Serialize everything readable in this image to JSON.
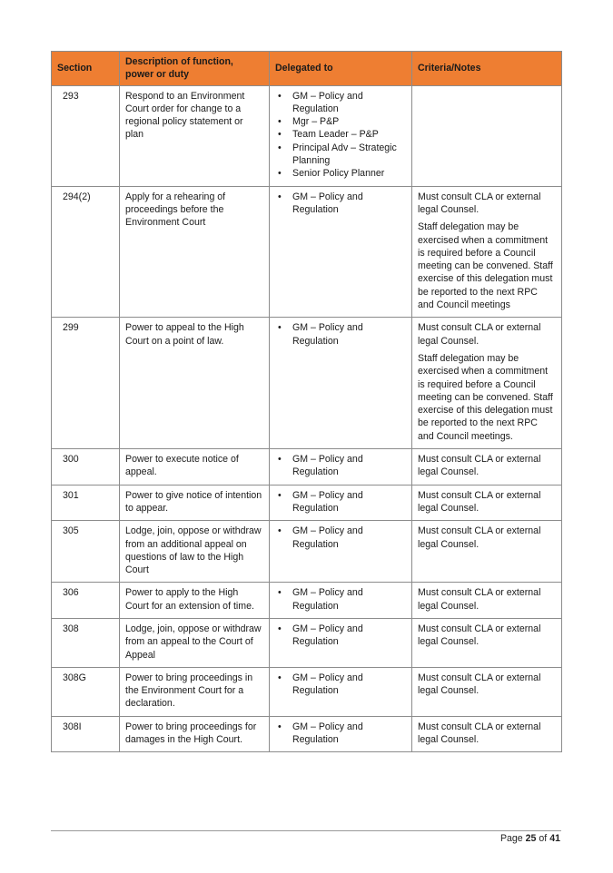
{
  "table": {
    "header_color": "#ee7e32",
    "headers": {
      "section": "Section",
      "description": "Description of function, power or duty",
      "delegated": "Delegated to",
      "criteria": "Criteria/Notes"
    },
    "rows": [
      {
        "section": "293",
        "description": "Respond to an Environment Court order for change to a regional policy statement or plan",
        "delegated": [
          "GM – Policy and Regulation",
          "Mgr – P&P",
          "Team Leader – P&P",
          "Principal Adv – Strategic Planning",
          "Senior Policy Planner"
        ],
        "notes": []
      },
      {
        "section": "294(2)",
        "description": "Apply for a rehearing of proceedings before the Environment Court",
        "delegated": [
          "GM – Policy and Regulation"
        ],
        "notes": [
          "Must consult CLA or external legal Counsel.",
          "Staff delegation may be exercised when a commitment is required before a Council meeting can be convened. Staff exercise of this delegation must be reported to the next RPC and Council meetings"
        ]
      },
      {
        "section": "299",
        "description": "Power to appeal to the High Court on a point of law.",
        "delegated": [
          "GM – Policy and Regulation"
        ],
        "notes": [
          "Must consult CLA or external legal Counsel.",
          "Staff delegation may be exercised when a commitment is required before a Council meeting can be convened. Staff exercise of this delegation must be reported to the next RPC and Council meetings."
        ]
      },
      {
        "section": "300",
        "description": "Power to execute notice of appeal.",
        "delegated": [
          "GM – Policy and Regulation"
        ],
        "notes": [
          "Must consult CLA or external legal Counsel."
        ]
      },
      {
        "section": "301",
        "description": "Power to give notice of intention to appear.",
        "delegated": [
          "GM – Policy and Regulation"
        ],
        "notes": [
          "Must consult CLA or external legal Counsel."
        ]
      },
      {
        "section": "305",
        "description": "Lodge, join, oppose or withdraw from an additional appeal on questions of law to the High Court",
        "delegated": [
          "GM – Policy and Regulation"
        ],
        "notes": [
          "Must consult CLA or external legal Counsel."
        ]
      },
      {
        "section": "306",
        "description": "Power to apply to the High Court for an extension of time.",
        "delegated": [
          "GM – Policy and Regulation"
        ],
        "notes": [
          "Must consult CLA or external legal Counsel."
        ]
      },
      {
        "section": "308",
        "description": "Lodge, join, oppose or withdraw from an appeal to the Court of Appeal",
        "delegated": [
          "GM – Policy and Regulation"
        ],
        "notes": [
          "Must consult CLA or external legal Counsel."
        ]
      },
      {
        "section": "308G",
        "description": "Power to bring proceedings in the Environment Court for a declaration.",
        "delegated": [
          "GM – Policy and Regulation"
        ],
        "notes": [
          "Must consult CLA or external legal Counsel."
        ]
      },
      {
        "section": "308I",
        "description": "Power to bring proceedings for damages in the High Court.",
        "delegated": [
          "GM – Policy and Regulation"
        ],
        "notes": [
          "Must consult CLA or external legal Counsel."
        ]
      }
    ]
  },
  "footer": {
    "page_label": "Page",
    "current_page": "25",
    "of_label": "of",
    "total_pages": "41"
  }
}
